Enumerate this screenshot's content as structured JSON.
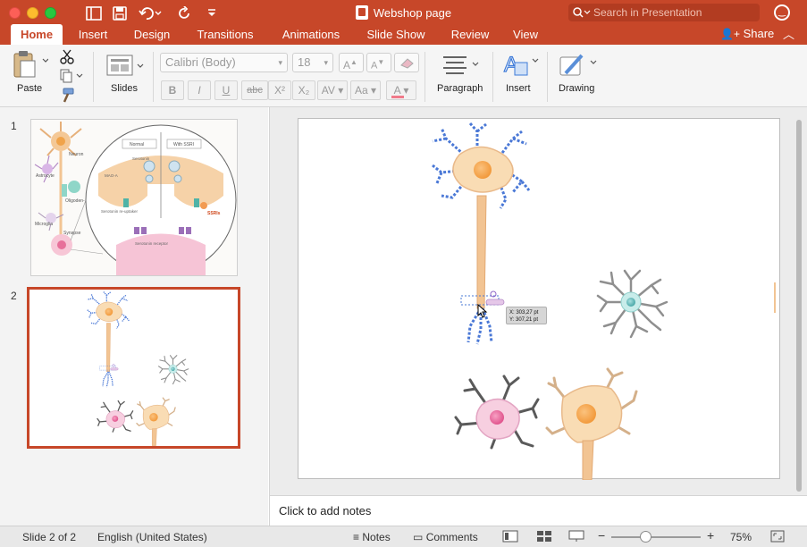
{
  "window": {
    "title": "Webshop page",
    "search_placeholder": "Search in Presentation"
  },
  "tabs": [
    {
      "label": "Home",
      "active": true
    },
    {
      "label": "Insert"
    },
    {
      "label": "Design"
    },
    {
      "label": "Transitions"
    },
    {
      "label": "Animations"
    },
    {
      "label": "Slide Show"
    },
    {
      "label": "Review"
    },
    {
      "label": "View"
    }
  ],
  "share_label": "Share",
  "ribbon": {
    "paste_label": "Paste",
    "slides_label": "Slides",
    "font_name": "Calibri (Body)",
    "font_size": "18",
    "format_buttons": [
      "B",
      "I",
      "U",
      "abc",
      "X²",
      "X₂",
      "AV",
      "Aa",
      "A"
    ],
    "paragraph_label": "Paragraph",
    "insert_label": "Insert",
    "drawing_label": "Drawing",
    "accent_color": "#c74729"
  },
  "thumbnails": [
    {
      "number": "1",
      "labels": {
        "neuron": "Neuron",
        "astrocyte": "Astrocyte",
        "oligodendrocyte": "Oligoden-\ndrocyte",
        "microglia": "Microglia",
        "synapse": "Synapse",
        "normal": "Normal",
        "with_ssri": "With SSRI",
        "serotonin": "Serotonin",
        "maoa": "MAO-A",
        "reuptake": "Serotonin\nre-uptaker",
        "ssris": "SSRIs",
        "receptor": "Serotonin\nreceptor"
      }
    },
    {
      "number": "2",
      "selected": true
    }
  ],
  "slide": {
    "coord_tooltip": {
      "x": "X: 303,27 pt",
      "y": "Y: 307,21 pt"
    }
  },
  "notes_placeholder": "Click to add notes",
  "status": {
    "slide_indicator": "Slide 2 of 2",
    "language": "English (United States)",
    "notes_label": "Notes",
    "comments_label": "Comments",
    "zoom": "75%",
    "zoom_minus": "−",
    "zoom_plus": "+"
  }
}
